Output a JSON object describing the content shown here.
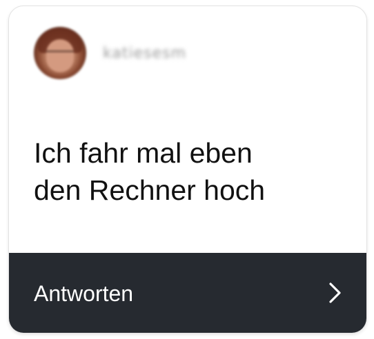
{
  "post": {
    "username": "katiesesm",
    "message": "Ich fahr mal eben\nden Rechner hoch"
  },
  "footer": {
    "reply_label": "Antworten",
    "chevron_icon": "chevron-right-icon"
  },
  "colors": {
    "card_background": "#ffffff",
    "footer_background": "#262a30",
    "message_text": "#111111",
    "footer_text": "#ffffff"
  }
}
